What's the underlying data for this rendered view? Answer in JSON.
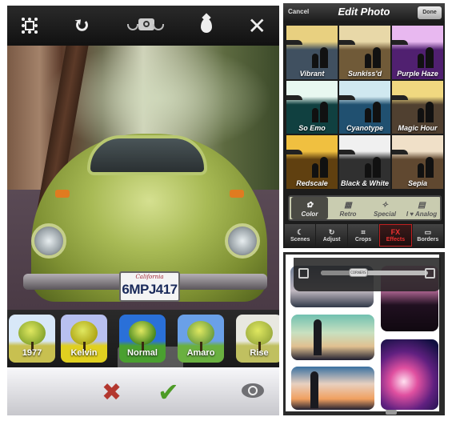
{
  "left_app": {
    "toolbar": {
      "icons": [
        "frame-icon",
        "rotate-icon",
        "flip-camera-icon",
        "blur-drop-icon",
        "close-icon"
      ],
      "rotate_glyph": "↻",
      "close_glyph": "✕"
    },
    "photo": {
      "license_plate_state": "California",
      "license_plate_number": "6MPJ417"
    },
    "filters": [
      {
        "label": "1977",
        "sky": "#d8e8f8",
        "tree": "#8aa830",
        "ground": "#c8c050"
      },
      {
        "label": "Kelvin",
        "sky": "#b8c0f0",
        "tree": "#b0a818",
        "ground": "#e0d020"
      },
      {
        "label": "Normal",
        "sky": "#2a70d8",
        "tree": "#4a8a20",
        "ground": "#4aa030"
      },
      {
        "label": "Amaro",
        "sky": "#6aa0e8",
        "tree": "#70a040",
        "ground": "#6ab040"
      },
      {
        "label": "Rise",
        "sky": "#e8e8e0",
        "tree": "#a0b040",
        "ground": "#c0c060"
      }
    ],
    "selected_filter": "Normal",
    "bottom_bar": {
      "cancel_glyph": "✖",
      "confirm_glyph": "✔",
      "preview_icon": "eye-icon"
    }
  },
  "right_top_app": {
    "header": {
      "cancel_label": "Cancel",
      "title": "Edit Photo",
      "done_label": "Done"
    },
    "effects": [
      {
        "label": "Vibrant",
        "top": "#e8d080",
        "bottom": "#405060"
      },
      {
        "label": "Sunkiss'd",
        "top": "#e8d8a8",
        "bottom": "#705a38"
      },
      {
        "label": "Purple Haze",
        "top": "#e8b8f0",
        "bottom": "#502070"
      },
      {
        "label": "So Emo",
        "top": "#e8f8f0",
        "bottom": "#104040"
      },
      {
        "label": "Cyanotype",
        "top": "#d0e8f0",
        "bottom": "#205070"
      },
      {
        "label": "Magic Hour",
        "top": "#f0d880",
        "bottom": "#504030"
      },
      {
        "label": "Redscale",
        "top": "#f0c040",
        "bottom": "#604010"
      },
      {
        "label": "Black & White",
        "top": "#f0f0f0",
        "bottom": "#303030"
      },
      {
        "label": "Sepia",
        "top": "#f0e0c8",
        "bottom": "#604830"
      }
    ],
    "categories": [
      {
        "label": "Color",
        "icon": "color-wheel-icon",
        "glyph": "✿",
        "active": true
      },
      {
        "label": "Retro",
        "icon": "retro-icon",
        "glyph": "▦",
        "active": false
      },
      {
        "label": "Special",
        "icon": "magic-wand-icon",
        "glyph": "✧",
        "active": false
      },
      {
        "label": "I ♥ Analog",
        "icon": "analog-icon",
        "glyph": "▤",
        "active": false
      }
    ],
    "tool_tabs": [
      {
        "label": "Scenes",
        "glyph": "☾",
        "active": false
      },
      {
        "label": "Adjust",
        "glyph": "↻",
        "active": false
      },
      {
        "label": "Crops",
        "glyph": "⌗",
        "active": false
      },
      {
        "label": "Effects",
        "glyph": "FX",
        "active": true
      },
      {
        "label": "Borders",
        "glyph": "▭",
        "active": false
      }
    ],
    "accent_color": "#e02020"
  },
  "right_bottom_app": {
    "slider_thumb_label": "CORNERS",
    "slider_value": 0.35
  }
}
